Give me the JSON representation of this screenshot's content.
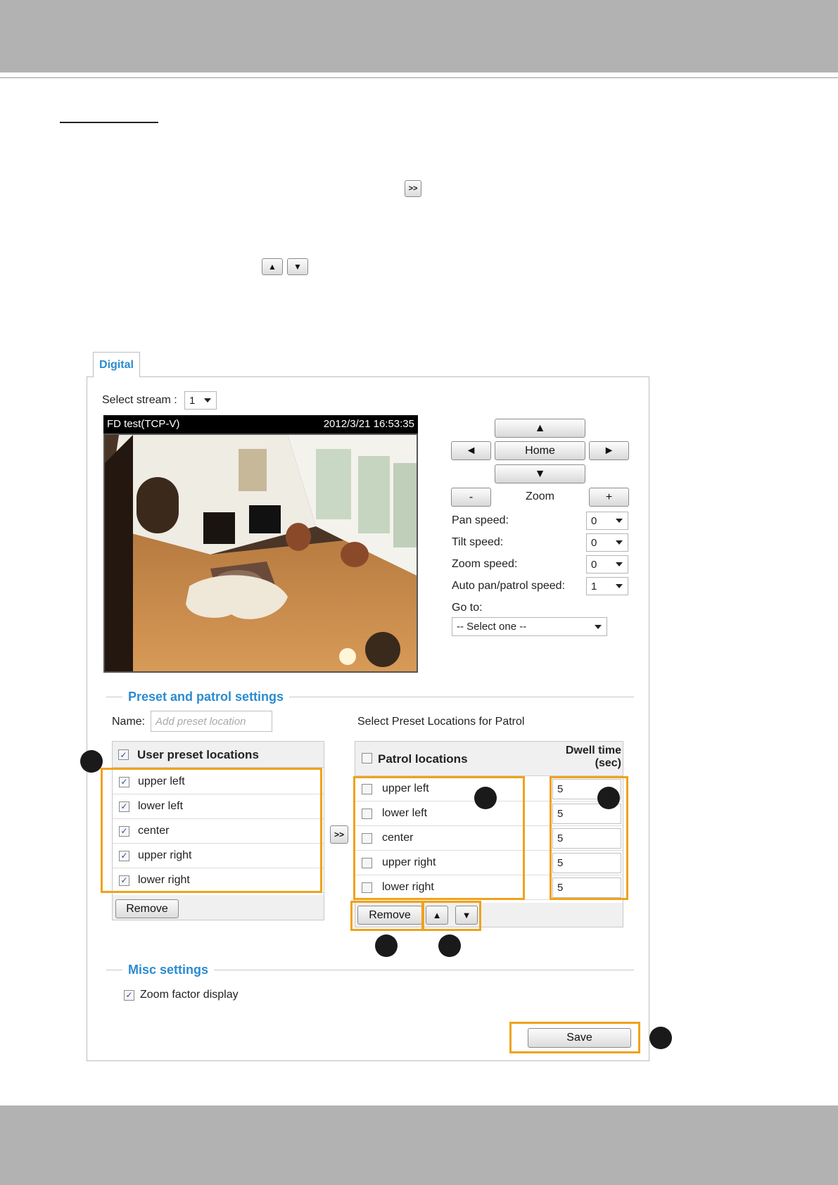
{
  "page": {
    "header_color": "#b2b2b2",
    "accent": "#2a8cd0",
    "highlight": "#f0a21a",
    "intro_icons": {
      "move_right_icon": ">>",
      "up_icon": "▲",
      "down_icon": "▼"
    }
  },
  "tab": {
    "label": "Digital"
  },
  "stream": {
    "label": "Select stream :",
    "value": "1"
  },
  "video": {
    "caption": "FD test(TCP-V)",
    "timestamp": "2012/3/21 16:53:35"
  },
  "ptz": {
    "up": "▲",
    "left": "◄",
    "home": "Home",
    "right": "►",
    "down": "▼",
    "zoom_out": "-",
    "zoom_label": "Zoom",
    "zoom_in": "+",
    "pan_speed": {
      "label": "Pan speed:",
      "value": "0"
    },
    "tilt_speed": {
      "label": "Tilt speed:",
      "value": "0"
    },
    "zoom_speed": {
      "label": "Zoom speed:",
      "value": "0"
    },
    "patrol_speed": {
      "label": "Auto pan/patrol speed:",
      "value": "1"
    },
    "goto": {
      "label": "Go to:",
      "value": "-- Select one --"
    }
  },
  "preset": {
    "legend": "Preset and patrol settings",
    "name_label": "Name:",
    "name_placeholder": "Add preset location",
    "user_header": "User preset locations",
    "user_items": [
      "upper left",
      "lower left",
      "center",
      "upper right",
      "lower right"
    ],
    "remove": "Remove",
    "move_button": ">>",
    "patrol_title": "Select Preset Locations for Patrol",
    "patrol_header": "Patrol locations",
    "dwell_header_1": "Dwell time",
    "dwell_header_2": "(sec)",
    "patrol_items": [
      {
        "label": "upper left",
        "dwell": "5"
      },
      {
        "label": "lower left",
        "dwell": "5"
      },
      {
        "label": "center",
        "dwell": "5"
      },
      {
        "label": "upper right",
        "dwell": "5"
      },
      {
        "label": "lower right",
        "dwell": "5"
      }
    ],
    "patrol_remove": "Remove",
    "move_up": "▲",
    "move_down": "▼"
  },
  "misc": {
    "legend": "Misc settings",
    "zoom_factor": "Zoom factor display"
  },
  "save": "Save"
}
